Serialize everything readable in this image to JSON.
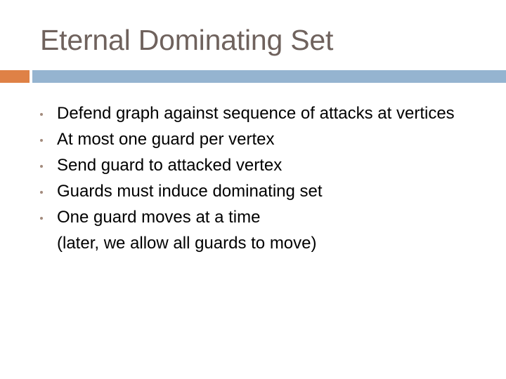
{
  "slide": {
    "title": "Eternal Dominating Set",
    "colors": {
      "title": "#6f625d",
      "accent_orange": "#df8146",
      "accent_blue": "#95b4d0",
      "bullet": "#a38b7d",
      "body_text": "#000000"
    },
    "bullets": [
      {
        "text": "Defend graph against sequence of attacks at vertices",
        "bullet": true
      },
      {
        "text": "At most one guard per vertex",
        "bullet": true
      },
      {
        "text": "Send guard to attacked vertex",
        "bullet": true
      },
      {
        "text": "Guards must induce dominating set",
        "bullet": true
      },
      {
        "text": "One guard moves at a time",
        "bullet": true
      },
      {
        "text": "(later, we allow all guards to move)",
        "bullet": false
      }
    ]
  }
}
